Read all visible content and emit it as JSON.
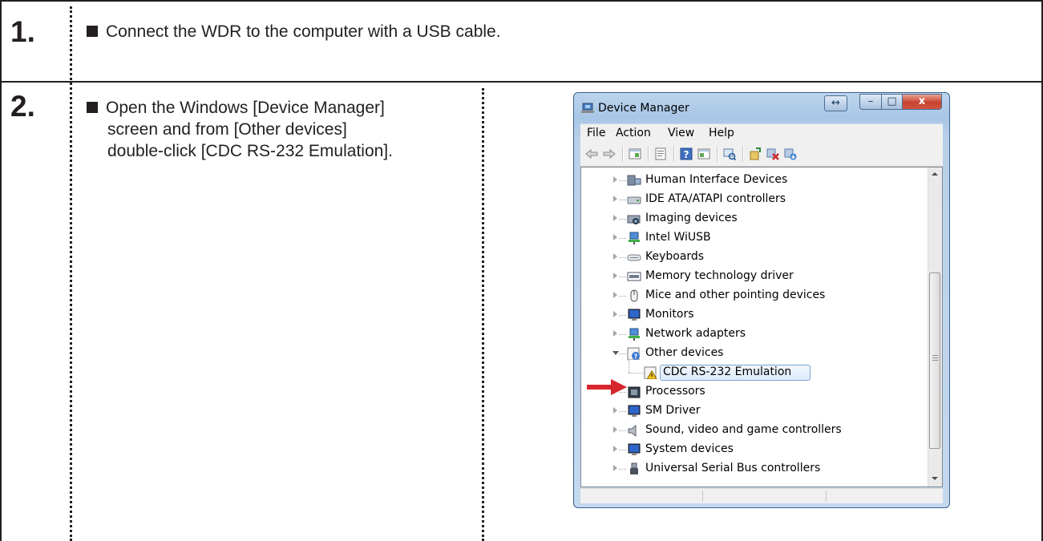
{
  "steps": [
    {
      "number": "1.",
      "text": "Connect the WDR to the computer with a USB cable."
    },
    {
      "number": "2.",
      "lines": [
        "Open the Windows [Device Manager]",
        "screen and from [Other devices]",
        "double-click [CDC RS-232 Emulation]."
      ]
    }
  ],
  "window": {
    "title": "Device Manager",
    "buttons": {
      "resize": "↔",
      "minimize": "–",
      "maximize": "□",
      "close": "x"
    },
    "menu": [
      "File",
      "Action",
      "View",
      "Help"
    ],
    "tree": [
      {
        "label": "Human Interface Devices",
        "icon": "hid-icon",
        "expanded": false
      },
      {
        "label": "IDE ATA/ATAPI controllers",
        "icon": "ide-icon",
        "expanded": false
      },
      {
        "label": "Imaging devices",
        "icon": "camera-icon",
        "expanded": false
      },
      {
        "label": "Intel WiUSB",
        "icon": "network-icon",
        "expanded": false
      },
      {
        "label": "Keyboards",
        "icon": "keyboard-icon",
        "expanded": false
      },
      {
        "label": "Memory technology driver",
        "icon": "memory-icon",
        "expanded": false
      },
      {
        "label": "Mice and other pointing devices",
        "icon": "mouse-icon",
        "expanded": false
      },
      {
        "label": "Monitors",
        "icon": "monitor-icon",
        "expanded": false
      },
      {
        "label": "Network adapters",
        "icon": "network-icon",
        "expanded": false
      },
      {
        "label": "Other devices",
        "icon": "unknown-device-icon",
        "expanded": true
      },
      {
        "label": "CDC RS-232 Emulation",
        "icon": "warning-device-icon",
        "child": true,
        "selected": true
      },
      {
        "label": "Processors",
        "icon": "processor-icon",
        "expanded": false
      },
      {
        "label": "SM Driver",
        "icon": "monitor-icon",
        "expanded": false
      },
      {
        "label": "Sound, video and game controllers",
        "icon": "speaker-icon",
        "expanded": false
      },
      {
        "label": "System devices",
        "icon": "monitor-icon",
        "expanded": false
      },
      {
        "label": "Universal Serial Bus controllers",
        "icon": "usb-icon",
        "expanded": false
      }
    ]
  },
  "colors": {
    "arrow": "#d7262e",
    "line": "#231f20"
  }
}
